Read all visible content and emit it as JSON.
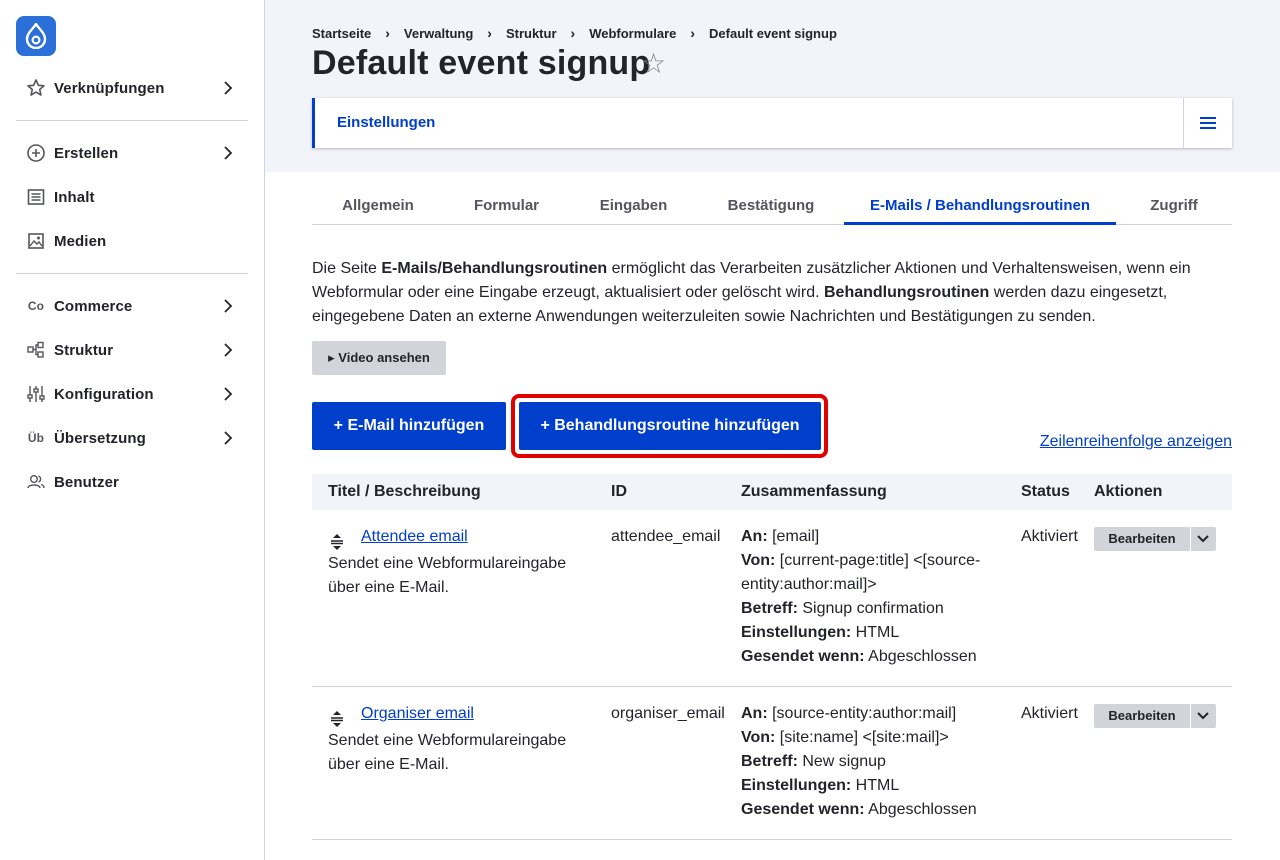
{
  "sidebar": {
    "items": [
      {
        "label": "Verknüpfungen",
        "icon": "star-icon"
      },
      {
        "label": "Erstellen",
        "icon": "plus-circle-icon"
      },
      {
        "label": "Inhalt",
        "icon": "document-icon"
      },
      {
        "label": "Medien",
        "icon": "image-icon"
      },
      {
        "label": "Commerce",
        "icon": "co-icon",
        "icon_text": "Co"
      },
      {
        "label": "Struktur",
        "icon": "structure-icon"
      },
      {
        "label": "Konfiguration",
        "icon": "sliders-icon"
      },
      {
        "label": "Übersetzung",
        "icon": "ub-icon",
        "icon_text": "Üb"
      },
      {
        "label": "Benutzer",
        "icon": "users-icon"
      }
    ]
  },
  "breadcrumb": [
    "Startseite",
    "Verwaltung",
    "Struktur",
    "Webformulare",
    "Default event signup"
  ],
  "page_title": "Default event signup",
  "local_tab": "Einstellungen",
  "secondary_tabs": [
    "Allgemein",
    "Formular",
    "Eingaben",
    "Bestätigung",
    "E-Mails / Behandlungsroutinen",
    "Zugriff"
  ],
  "description": {
    "p1": "Die Seite ",
    "b1": "E-Mails/Behandlungsroutinen",
    "p2": " ermöglicht das Verarbeiten zusätzlicher Aktionen und Verhaltensweisen, wenn ein Webformular oder eine Eingabe erzeugt, aktualisiert oder gelöscht wird. ",
    "b2": "Behandlungsroutinen",
    "p3": " werden dazu eingesetzt, eingegebene Daten an externe Anwendungen weiterzuleiten sowie Nachrichten und Bestätigungen zu senden."
  },
  "video_button": "▸ Video ansehen",
  "add_email_button": "+ E-Mail hinzufügen",
  "add_handler_button": "+ Behandlungsroutine hinzufügen",
  "row_order_link": "Zeilenreihenfolge anzeigen",
  "table": {
    "headers": [
      "Titel / Beschreibung",
      "ID",
      "Zusammenfassung",
      "Status",
      "Aktionen"
    ],
    "rows": [
      {
        "title": "Attendee email",
        "description": "Sendet eine Webformulareingabe über eine E-Mail.",
        "id": "attendee_email",
        "summary": [
          {
            "k": "An:",
            "v": " [email]"
          },
          {
            "k": "Von:",
            "v": " [current-page:title] <[source-entity:author:mail]>"
          },
          {
            "k": "Betreff:",
            "v": " Signup confirmation"
          },
          {
            "k": "Einstellungen:",
            "v": " HTML"
          },
          {
            "k": "Gesendet wenn:",
            "v": " Abgeschlossen"
          }
        ],
        "status": "Aktiviert",
        "action": "Bearbeiten"
      },
      {
        "title": "Organiser email",
        "description": "Sendet eine Webformulareingabe über eine E-Mail.",
        "id": "organiser_email",
        "summary": [
          {
            "k": "An:",
            "v": " [source-entity:author:mail]"
          },
          {
            "k": "Von:",
            "v": " [site:name] <[site:mail]>"
          },
          {
            "k": "Betreff:",
            "v": " New signup"
          },
          {
            "k": "Einstellungen:",
            "v": " HTML"
          },
          {
            "k": "Gesendet wenn:",
            "v": " Abgeschlossen"
          }
        ],
        "status": "Aktiviert",
        "action": "Bearbeiten"
      }
    ]
  },
  "colors": {
    "accent": "#003ecc",
    "highlight": "#e00000",
    "logo": "#2b6fd9"
  }
}
